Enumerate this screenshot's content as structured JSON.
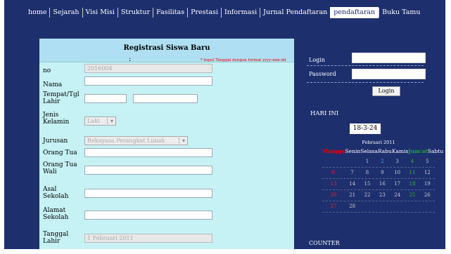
{
  "nav": {
    "items": [
      "home",
      "Sejarah",
      "Visi Misi",
      "Struktur",
      "Fasilitas",
      "Prestasi",
      "Informasi",
      "Jurnal Pendaftaran",
      "pendaftaran",
      "Buku Tamu"
    ],
    "active_index": 8
  },
  "form": {
    "title": "Registrasi Siswa Baru",
    "no_label": "no",
    "no_value": "2016004",
    "nama_label": "Nama",
    "ttl_label": "Tempat/Tgl Lahir",
    "date_hint": "* Input Tanggal dengan format yyyy-mm-dd",
    "jk_label": "Jenis Kelamin",
    "jk_value": "Laki",
    "jurusan_label": "Jurusan",
    "jurusan_value": "Rekayasa Perangkat Lunak",
    "ortu_label": "Orang Tua",
    "wali_label": "Orang Tua Wali",
    "asal_label": "Asal Sekolah",
    "alamat_label": "Alamat Sekolah",
    "tgl_label": "Tanggal Lahir",
    "tgl_value": "1 Februari 2011"
  },
  "login": {
    "login_label": "Login",
    "password_label": "Password",
    "button_label": "Login"
  },
  "hari_ini": {
    "title": "HARI INI",
    "date": "18-3-24"
  },
  "calendar": {
    "month": "Februari 2011",
    "days": [
      "Minggu",
      "Senin",
      "Selasa",
      "Rabu",
      "Kamis",
      "Jum'at",
      "Sabtu"
    ],
    "weeks": [
      [
        "",
        "",
        "1",
        "2",
        "3",
        "4",
        "5"
      ],
      [
        "6",
        "7",
        "8",
        "9",
        "10",
        "11",
        "12"
      ],
      [
        "13",
        "14",
        "15",
        "16",
        "17",
        "18",
        "19"
      ],
      [
        "20",
        "21",
        "22",
        "23",
        "24",
        "25",
        "26"
      ],
      [
        "27",
        "28",
        "",
        "",
        "",
        "",
        ""
      ]
    ],
    "today": "2"
  },
  "counter": {
    "title": "COUNTER"
  },
  "colors": {
    "background": "#1e2f6e",
    "form_bg": "#c6f2f5",
    "form_title_bg": "#aedff2",
    "sunday": "#e00",
    "friday": "#2a2"
  }
}
